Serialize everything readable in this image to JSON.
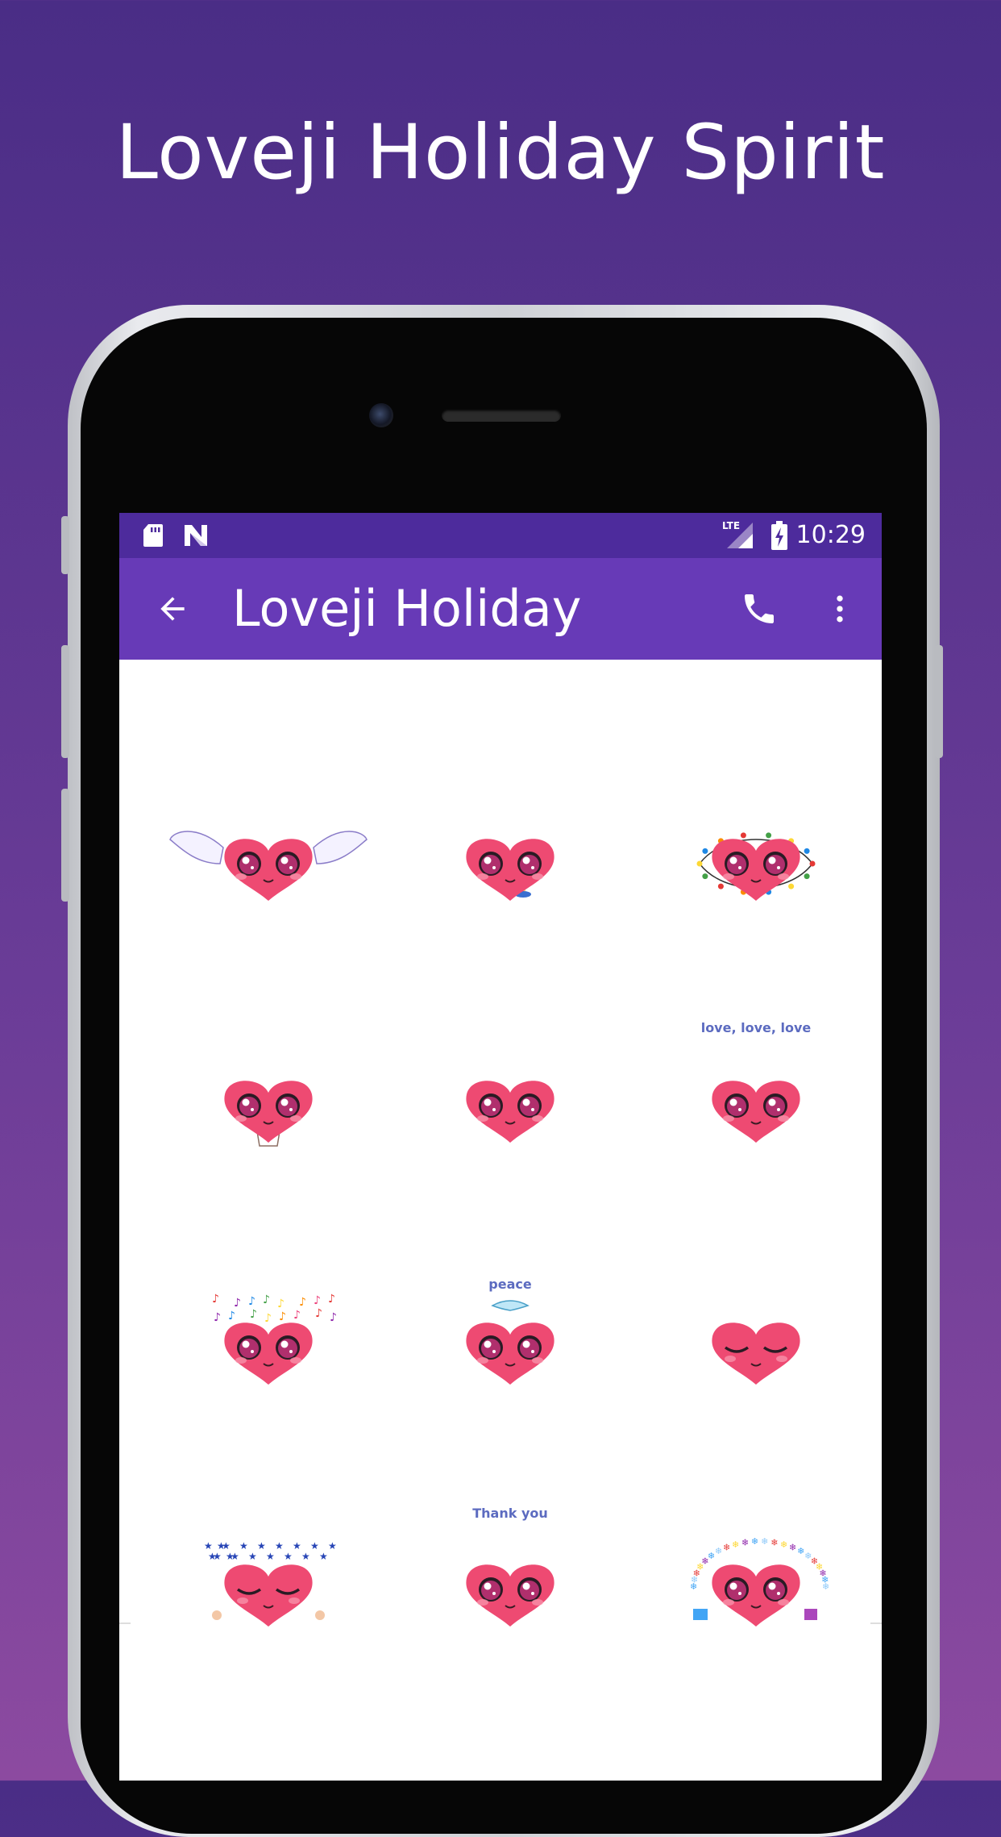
{
  "promo": {
    "title": "Loveji Holiday Spirit"
  },
  "status_bar": {
    "network": "LTE",
    "time": "10:29",
    "icons": [
      "sd-card-icon",
      "n-logo-icon",
      "lte-signal-icon",
      "battery-charging-icon"
    ]
  },
  "app_bar": {
    "title": "Loveji Holiday",
    "icons": [
      "back-arrow-icon",
      "phone-icon",
      "more-vert-icon"
    ]
  },
  "stickers": [
    {
      "name": "heart-wings-praying",
      "caption": ""
    },
    {
      "name": "heart-candle",
      "caption": ""
    },
    {
      "name": "heart-string-lights",
      "caption": ""
    },
    {
      "name": "heart-hot-cocoa",
      "caption": ""
    },
    {
      "name": "heart-smiling",
      "caption": ""
    },
    {
      "name": "heart-love",
      "caption": "love, love, love"
    },
    {
      "name": "heart-music-notes",
      "caption": ""
    },
    {
      "name": "heart-peace-dove",
      "caption": "peace"
    },
    {
      "name": "heart-eyes-closed-praying",
      "caption": ""
    },
    {
      "name": "heart-stars",
      "caption": ""
    },
    {
      "name": "heart-thank-you",
      "caption": "Thank you"
    },
    {
      "name": "heart-winter-gifts",
      "caption": ""
    }
  ],
  "colors": {
    "background_top": "#4a2d86",
    "background_bottom": "#8c4aa0",
    "status_bar": "#4d2b9c",
    "app_bar": "#673ab7",
    "heart": "#ee4a72",
    "eye": "#b02f6d"
  }
}
